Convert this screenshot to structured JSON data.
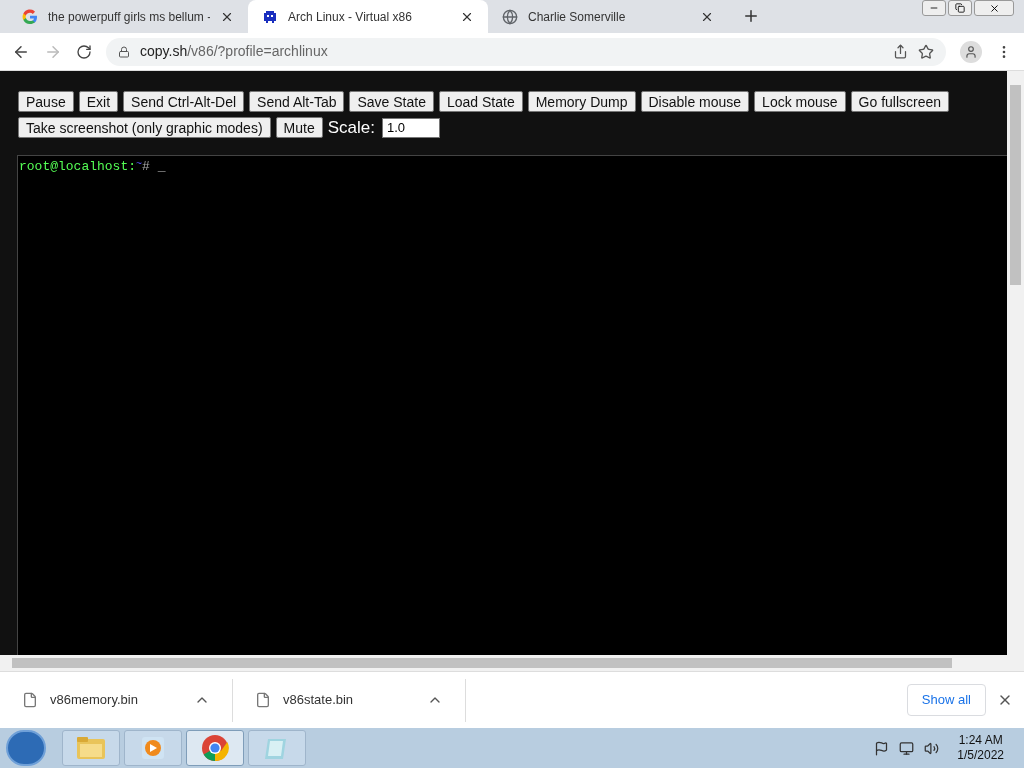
{
  "tabs": [
    {
      "title": "the powerpuff girls ms bellum -",
      "kind": "google",
      "selected": false
    },
    {
      "title": "Arch Linux - Virtual x86",
      "kind": "invader",
      "selected": true
    },
    {
      "title": "Charlie Somerville",
      "kind": "globe",
      "selected": false
    }
  ],
  "address": {
    "host": "copy.sh",
    "path": "/v86/?profile=archlinux"
  },
  "buttons_row1": [
    "Pause",
    "Exit",
    "Send Ctrl-Alt-Del",
    "Send Alt-Tab",
    "Save State",
    "Load State",
    "Memory Dump",
    "Disable mouse",
    "Lock mouse",
    "Go fullscreen"
  ],
  "buttons_row2": [
    "Take screenshot (only graphic modes)",
    "Mute"
  ],
  "scale": {
    "label": "Scale:",
    "value": "1.0"
  },
  "terminal": {
    "user_host": "root@localhost:",
    "dir": "~",
    "prompt": "#",
    "cursor": "_"
  },
  "downloads": [
    {
      "name": "v86memory.bin"
    },
    {
      "name": "v86state.bin"
    }
  ],
  "show_all": "Show all",
  "taskbar": {
    "apps": [
      {
        "kind": "folder",
        "selected": false
      },
      {
        "kind": "media",
        "selected": false
      },
      {
        "kind": "chrome",
        "selected": true
      },
      {
        "kind": "notepad",
        "selected": false
      }
    ],
    "time": "1:24 AM",
    "date": "1/5/2022"
  }
}
